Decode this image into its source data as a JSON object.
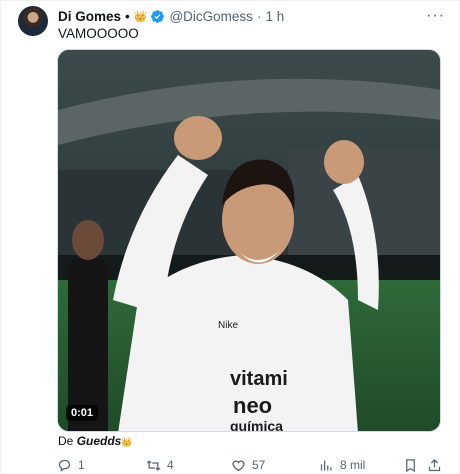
{
  "tweet": {
    "display_name": "Di Gomes",
    "separator": "•",
    "crown_glyph": "👑",
    "handle": "@DicGomess",
    "time_separator": "·",
    "time": "1 h",
    "text": "VAMOOOOO",
    "more_icon": "more-options-icon",
    "media": {
      "video_time": "0:01",
      "jersey_text_1": "vitami",
      "jersey_text_2": "neo",
      "jersey_text_3": "química",
      "jersey_sponsor": "Nike"
    },
    "credit_prefix": "De",
    "credit_author": "Guedds",
    "credit_crown": "👑"
  },
  "actions": {
    "replies": "1",
    "retweets": "4",
    "likes": "57",
    "views": "8 mil"
  },
  "colors": {
    "text_primary": "#0f1419",
    "text_secondary": "#536471",
    "verified": "#1d9bf0"
  }
}
